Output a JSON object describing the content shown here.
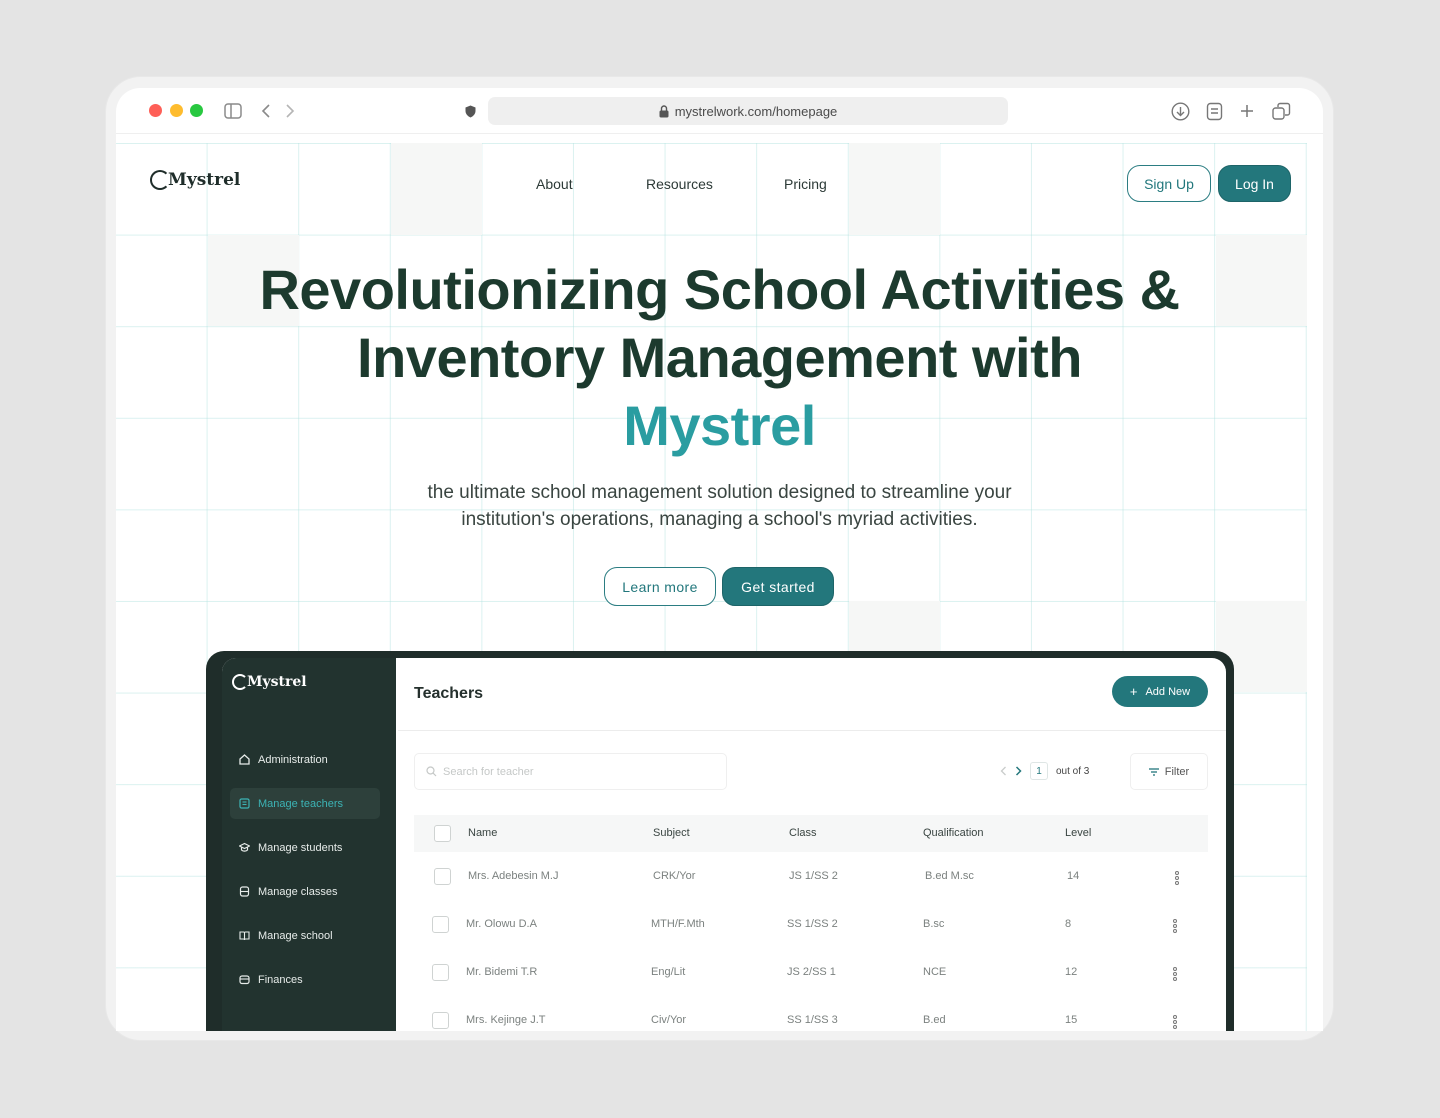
{
  "browser": {
    "url": "mystrelwork.com/homepage"
  },
  "nav": {
    "logo": "Mystrel",
    "links": [
      "About",
      "Resources",
      "Pricing"
    ],
    "signup_label": "Sign Up",
    "login_label": "Log In"
  },
  "hero": {
    "title_line1": "Revolutionizing School Activities &",
    "title_line2": "Inventory Management with",
    "title_brand": "Mystrel",
    "subtitle": "the ultimate school management solution designed to streamline your institution's operations, managing a school's myriad activities.",
    "learn_more_label": "Learn more",
    "get_started_label": "Get started"
  },
  "dashboard": {
    "logo": "Mystrel",
    "sidebar": [
      {
        "label": "Administration",
        "icon": "home-icon"
      },
      {
        "label": "Manage teachers",
        "icon": "book-icon",
        "active": true
      },
      {
        "label": "Manage students",
        "icon": "graduation-cap-icon"
      },
      {
        "label": "Manage classes",
        "icon": "classroom-icon"
      },
      {
        "label": "Manage school",
        "icon": "open-book-icon"
      },
      {
        "label": "Finances",
        "icon": "wallet-icon"
      }
    ],
    "title": "Teachers",
    "add_new_label": "Add New",
    "search_placeholder": "Search for teacher",
    "pagination": {
      "current": "1",
      "total_text": "out of 3"
    },
    "filter_label": "Filter",
    "columns": [
      "Name",
      "Subject",
      "Class",
      "Qualification",
      "Level"
    ],
    "rows": [
      {
        "name": "Mrs. Adebesin M.J",
        "subject": "CRK/Yor",
        "class": "JS 1/SS 2",
        "qualification": "B.ed M.sc",
        "level": "14"
      },
      {
        "name": "Mr. Olowu D.A",
        "subject": "MTH/F.Mth",
        "class": "SS 1/SS 2",
        "qualification": "B.sc",
        "level": "8"
      },
      {
        "name": "Mr. Bidemi T.R",
        "subject": "Eng/Lit",
        "class": "JS 2/SS 1",
        "qualification": "NCE",
        "level": "12"
      },
      {
        "name": "Mrs. Kejinge J.T",
        "subject": "Civ/Yor",
        "class": "SS 1/SS 3",
        "qualification": "B.ed",
        "level": "15"
      }
    ]
  },
  "colors": {
    "brand_teal": "#23777c",
    "brand_light_teal": "#2a9da1",
    "dark_green": "#1c3a2e",
    "sidebar_bg": "#22332f"
  }
}
